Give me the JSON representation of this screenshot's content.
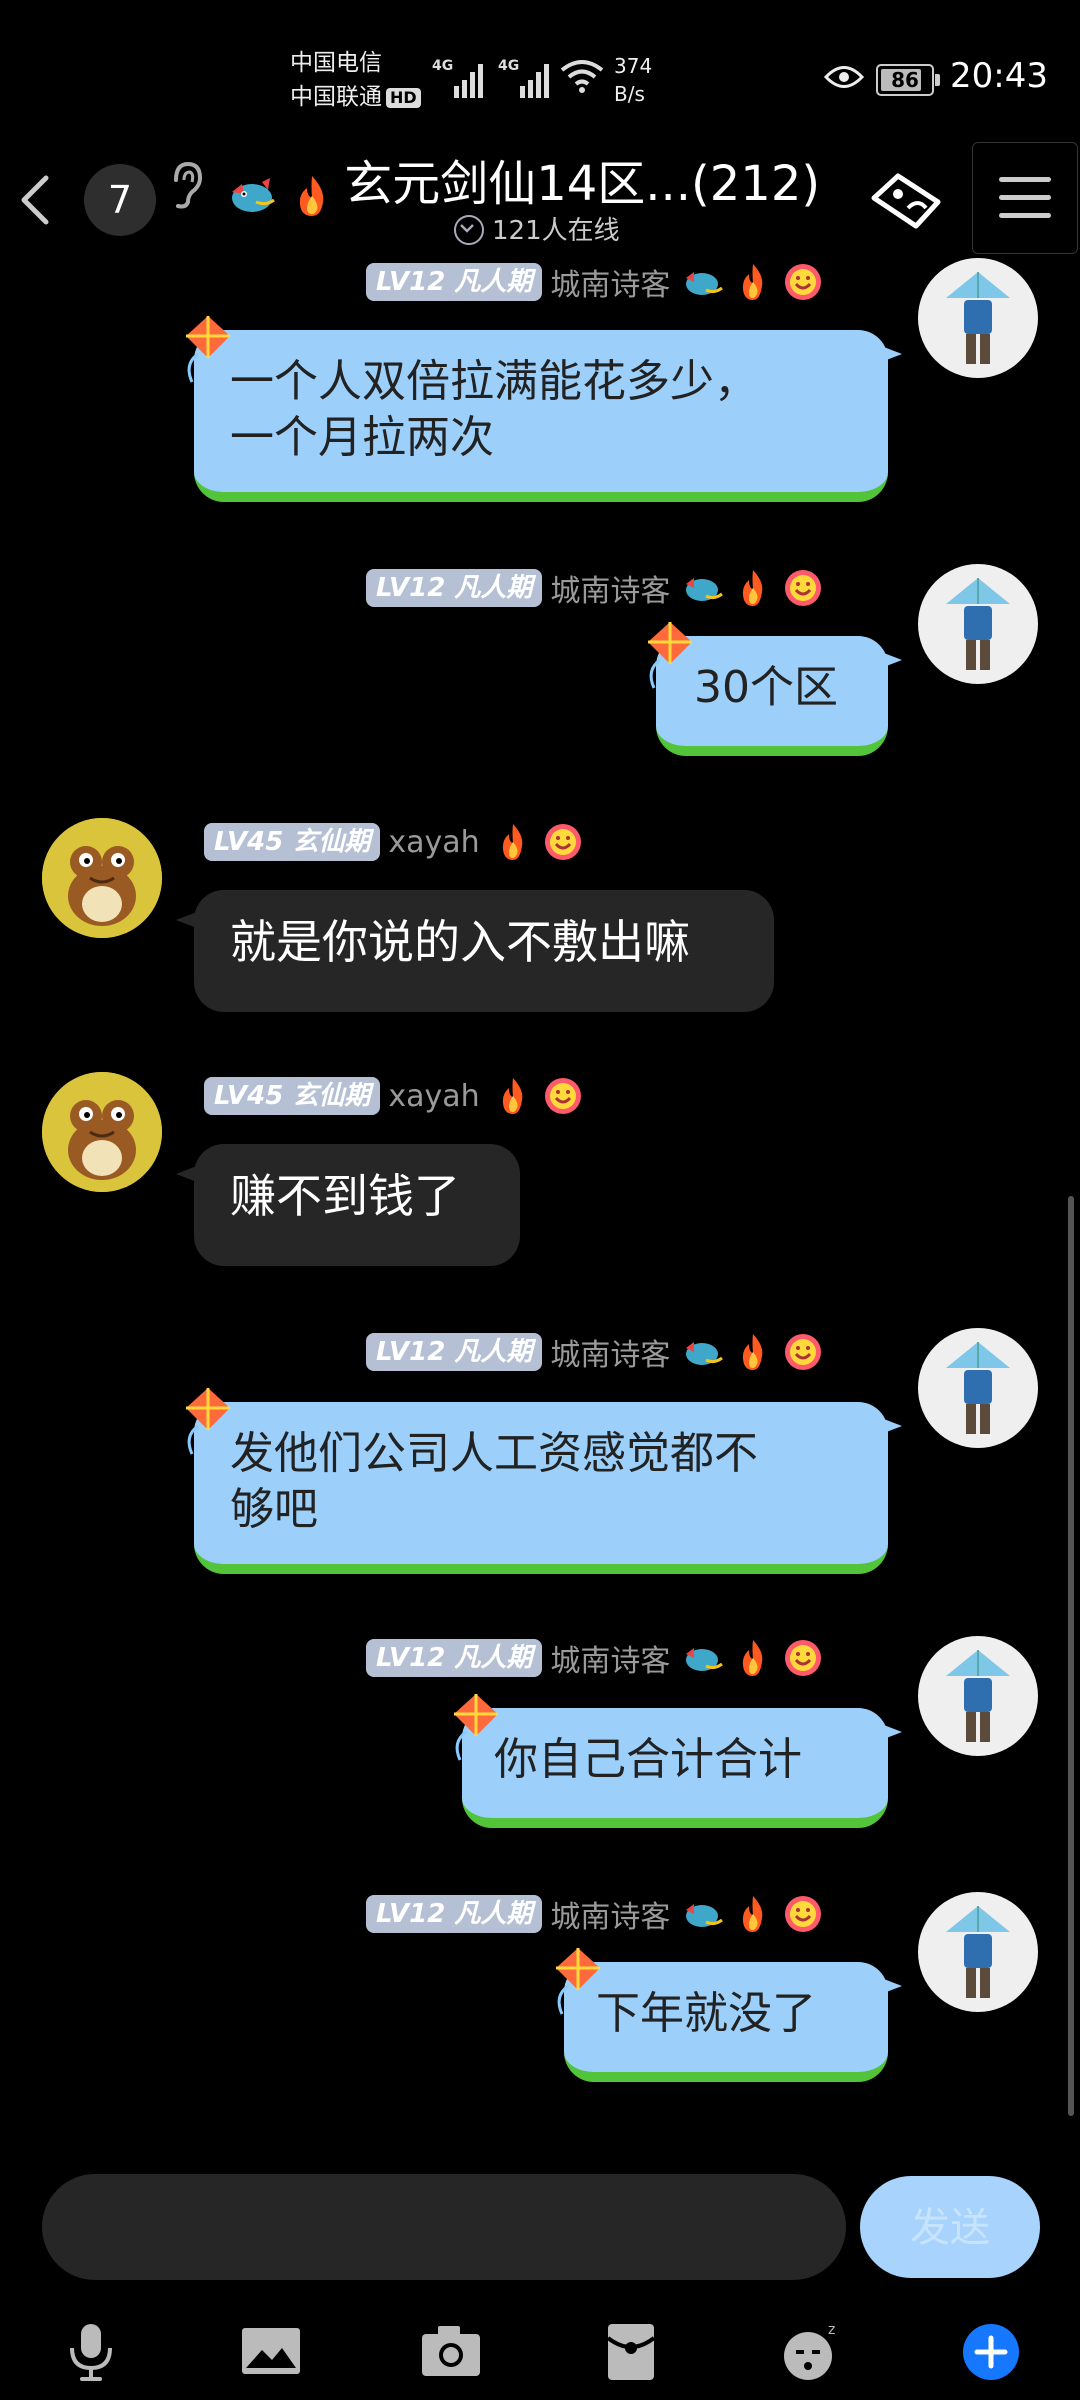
{
  "status_bar": {
    "carrier1": "中国电信",
    "carrier2": "中国联通",
    "hd": "HD",
    "network1": "4G",
    "network2": "4G",
    "speed_value": "374",
    "speed_unit": "B/s",
    "battery": "86",
    "time": "20:43"
  },
  "header": {
    "unread_count": "7",
    "title": "玄元剑仙14区...(212)",
    "online": "121人在线",
    "title_emojis": [
      "dragon-emoji",
      "fire-emoji"
    ]
  },
  "messages": [
    {
      "side": "me",
      "level": "LV12 凡人期",
      "user": "城南诗客",
      "lines": [
        "一个人双倍拉满能花多少，",
        "一个月拉两次"
      ]
    },
    {
      "side": "me",
      "level": "LV12 凡人期",
      "user": "城南诗客",
      "lines": [
        "30个区"
      ]
    },
    {
      "side": "other",
      "level": "LV45 玄仙期",
      "user": "xayah",
      "lines": [
        "就是你说的入不敷出嘛"
      ]
    },
    {
      "side": "other",
      "level": "LV45 玄仙期",
      "user": "xayah",
      "lines": [
        "赚不到钱了"
      ]
    },
    {
      "side": "me",
      "level": "LV12 凡人期",
      "user": "城南诗客",
      "lines": [
        "发他们公司人工资感觉都不",
        "够吧"
      ]
    },
    {
      "side": "me",
      "level": "LV12 凡人期",
      "user": "城南诗客",
      "lines": [
        "你自己合计合计"
      ]
    },
    {
      "side": "me",
      "level": "LV12 凡人期",
      "user": "城南诗客",
      "lines": [
        "下年就没了"
      ]
    }
  ],
  "input": {
    "placeholder": "",
    "send_label": "发送"
  },
  "toolbar": [
    "mic-icon",
    "image-icon",
    "camera-icon",
    "red-packet-icon",
    "sticker-icon",
    "plus-icon"
  ],
  "colors": {
    "background": "#000000",
    "my_bubble": "#9cd0fb",
    "my_bubble_grass": "#52c43a",
    "other_bubble": "#262626",
    "level_badge": "#b6c0d4",
    "send_button": "#a7d3fc",
    "plus_button": "#1677ff"
  }
}
